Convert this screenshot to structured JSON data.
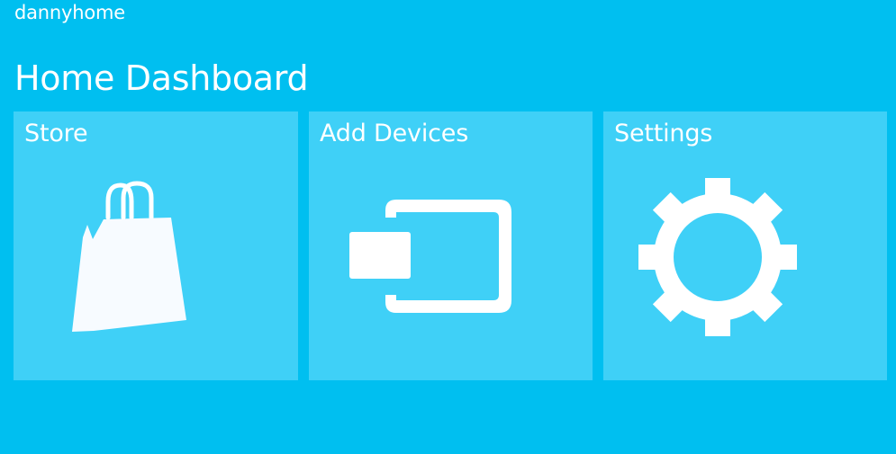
{
  "app": {
    "name": "dannyhome"
  },
  "header": {
    "title": "Home Dashboard"
  },
  "tiles": [
    {
      "label": "Store",
      "icon": "shopping-bag-icon"
    },
    {
      "label": "Add Devices",
      "icon": "device-plug-icon"
    },
    {
      "label": "Settings",
      "icon": "gear-icon"
    }
  ],
  "colors": {
    "background": "#00bff0",
    "tile": "#3fd0f7",
    "text": "#ffffff"
  }
}
